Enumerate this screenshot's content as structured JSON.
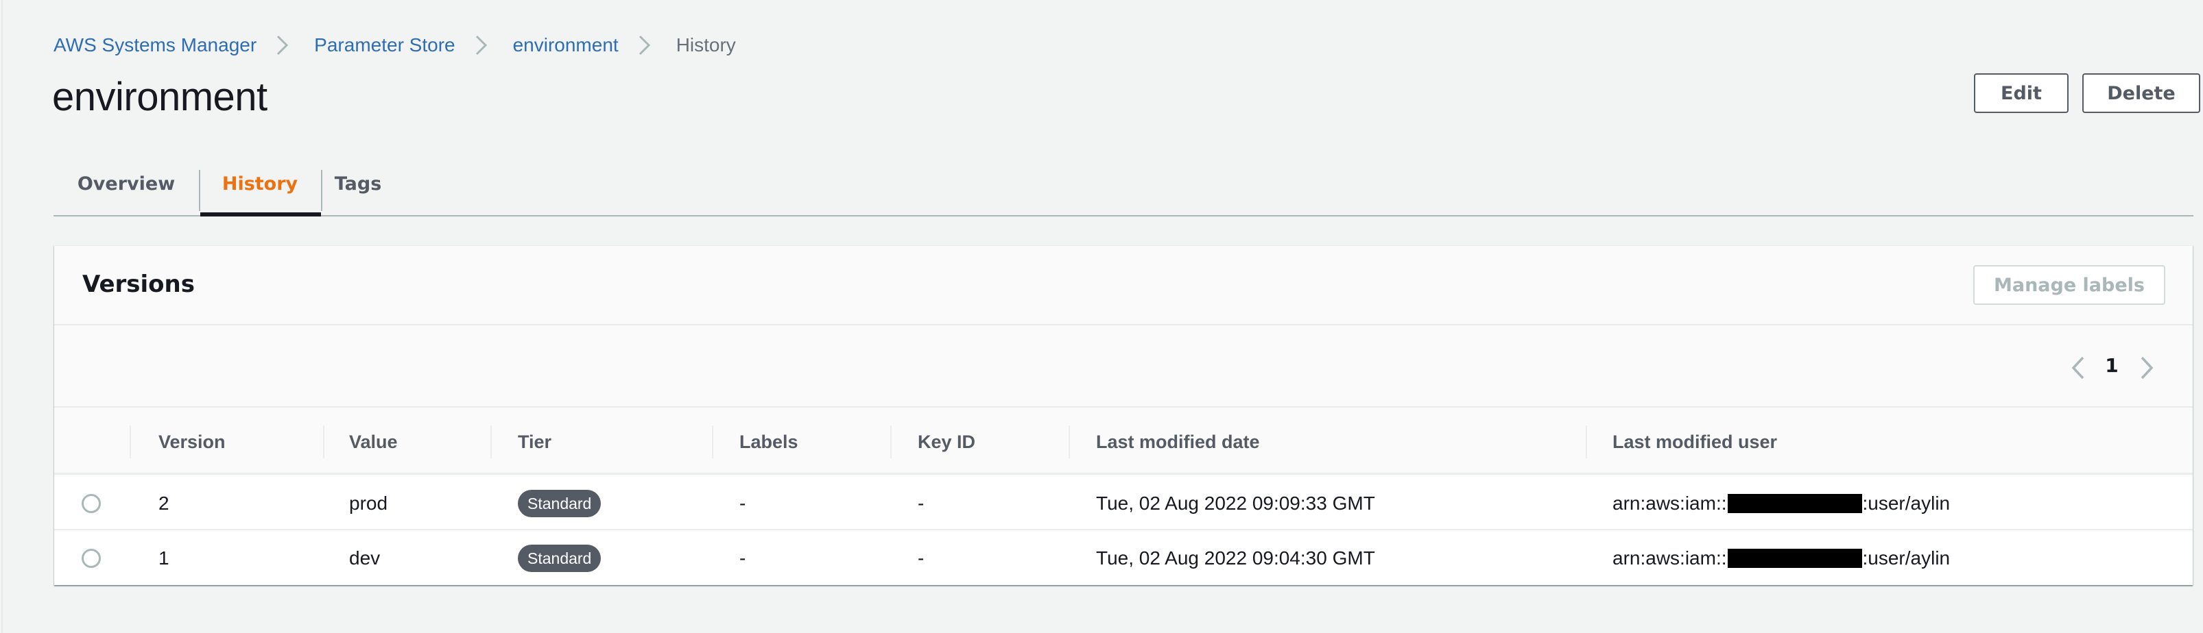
{
  "breadcrumb": {
    "items": [
      {
        "label": "AWS Systems Manager",
        "link": true
      },
      {
        "label": "Parameter Store",
        "link": true
      },
      {
        "label": "environment",
        "link": true
      },
      {
        "label": "History",
        "link": false
      }
    ],
    "separator_icon": "chevron-right-icon"
  },
  "header": {
    "title": "environment",
    "edit_label": "Edit",
    "delete_label": "Delete"
  },
  "tabs": [
    {
      "label": "Overview",
      "active": false
    },
    {
      "label": "History",
      "active": true
    },
    {
      "label": "Tags",
      "active": false
    }
  ],
  "versions": {
    "title": "Versions",
    "manage_labels_label": "Manage labels",
    "manage_labels_disabled": true,
    "pagination": {
      "current_page": "1",
      "prev_icon": "chevron-left-icon",
      "next_icon": "chevron-right-icon"
    },
    "columns": [
      "Version",
      "Value",
      "Tier",
      "Labels",
      "Key ID",
      "Last modified date",
      "Last modified user"
    ],
    "rows": [
      {
        "selected": false,
        "version": "2",
        "value": "prod",
        "tier": "Standard",
        "labels": "-",
        "key_id": "-",
        "last_modified_date": "Tue, 02 Aug 2022 09:09:33 GMT",
        "user_prefix": "arn:aws:iam::",
        "user_suffix": ":user/aylin"
      },
      {
        "selected": false,
        "version": "1",
        "value": "dev",
        "tier": "Standard",
        "labels": "-",
        "key_id": "-",
        "last_modified_date": "Tue, 02 Aug 2022 09:04:30 GMT",
        "user_prefix": "arn:aws:iam::",
        "user_suffix": ":user/aylin"
      }
    ]
  },
  "colors": {
    "link": "#2e6db4",
    "active_tab": "#ec7211",
    "badge_bg": "#545b64",
    "text": "#16191f",
    "muted": "#545b64"
  }
}
